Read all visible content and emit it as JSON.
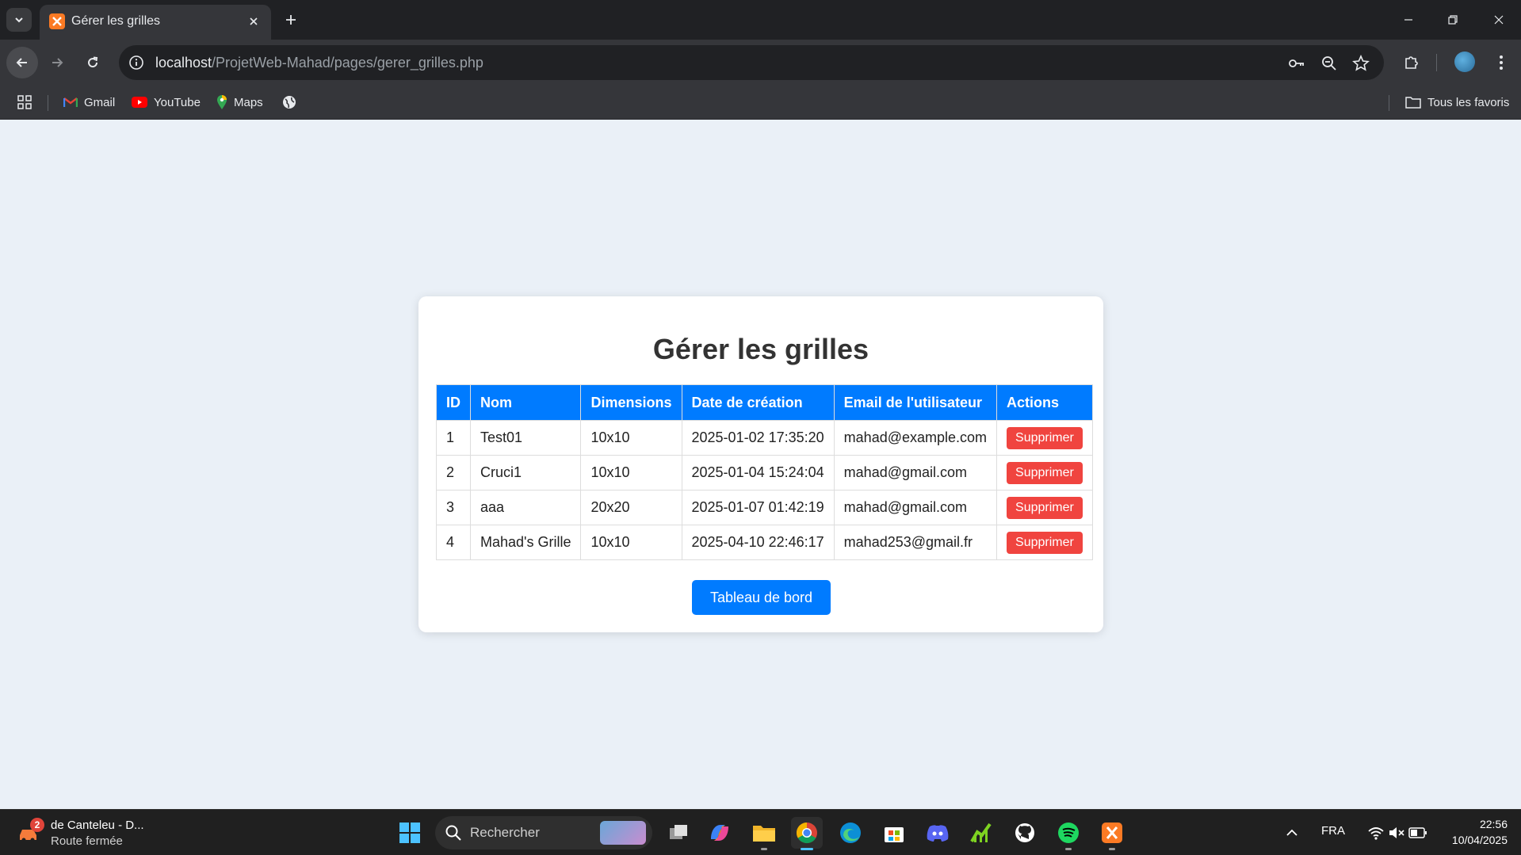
{
  "browser": {
    "tab_title": "Gérer les grilles",
    "url_host": "localhost",
    "url_path": "/ProjetWeb-Mahad/pages/gerer_grilles.php",
    "bookmarks": [
      {
        "label": "Gmail",
        "icon": "gmail-icon"
      },
      {
        "label": "YouTube",
        "icon": "youtube-icon"
      },
      {
        "label": "Maps",
        "icon": "maps-icon"
      }
    ],
    "all_bookmarks_label": "Tous les favoris"
  },
  "page": {
    "title": "Gérer les grilles",
    "table": {
      "headers": [
        "ID",
        "Nom",
        "Dimensions",
        "Date de création",
        "Email de l'utilisateur",
        "Actions"
      ],
      "rows": [
        {
          "id": "1",
          "nom": "Test01",
          "dimensions": "10x10",
          "date": "2025-01-02 17:35:20",
          "email": "mahad@example.com",
          "action": "Supprimer"
        },
        {
          "id": "2",
          "nom": "Cruci1",
          "dimensions": "10x10",
          "date": "2025-01-04 15:24:04",
          "email": "mahad@gmail.com",
          "action": "Supprimer"
        },
        {
          "id": "3",
          "nom": "aaa",
          "dimensions": "20x20",
          "date": "2025-01-07 01:42:19",
          "email": "mahad@gmail.com",
          "action": "Supprimer"
        },
        {
          "id": "4",
          "nom": "Mahad's Grille",
          "dimensions": "10x10",
          "date": "2025-04-10 22:46:17",
          "email": "mahad253@gmail.fr",
          "action": "Supprimer"
        }
      ]
    },
    "dashboard_button": "Tableau de bord"
  },
  "colors": {
    "header_blue": "#007bff",
    "delete_red": "#f0443f",
    "page_bg": "#eaf0f7"
  },
  "taskbar": {
    "weather_badge": "2",
    "weather_line1": "de Canteleu - D...",
    "weather_line2": "Route fermée",
    "search_placeholder": "Rechercher",
    "language": "FRA",
    "time": "22:56",
    "date": "10/04/2025"
  }
}
